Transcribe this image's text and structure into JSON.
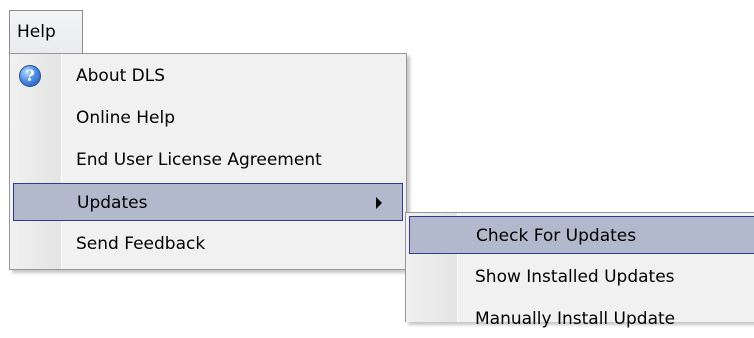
{
  "menubar": {
    "help_label": "Help"
  },
  "help_menu": {
    "items": [
      {
        "label": "About DLS",
        "icon": "info-icon"
      },
      {
        "label": "Online Help"
      },
      {
        "label": "End User License Agreement"
      },
      {
        "label": "Updates",
        "has_submenu": true,
        "highlighted": true
      },
      {
        "label": "Send Feedback"
      }
    ]
  },
  "updates_submenu": {
    "items": [
      {
        "label": "Check For Updates",
        "highlighted": true
      },
      {
        "label": "Show Installed Updates"
      },
      {
        "label": "Manually Install Update"
      }
    ]
  },
  "colors": {
    "highlight_fill": "#b3b9cd",
    "highlight_border": "#2e3e8d",
    "menu_background": "#f1f1f1"
  }
}
